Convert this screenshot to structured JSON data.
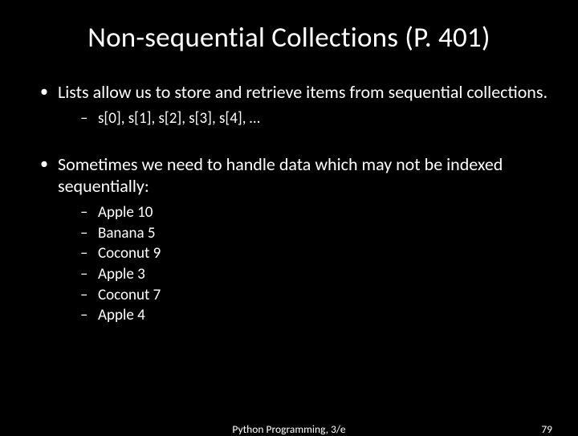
{
  "title": "Non-sequential Collections (P. 401)",
  "bullets": [
    {
      "text": "Lists allow us to store and retrieve items from sequential collections.",
      "sub": [
        "s[0], s[1], s[2], s[3], s[4], …"
      ]
    },
    {
      "text": "Sometimes we need to handle data which may not be indexed sequentially:",
      "sub": [
        "Apple 10",
        "Banana 5",
        "Coconut 9",
        "Apple 3",
        "Coconut 7",
        "Apple 4"
      ]
    }
  ],
  "footer": {
    "center": "Python Programming, 3/e",
    "page": "79"
  }
}
